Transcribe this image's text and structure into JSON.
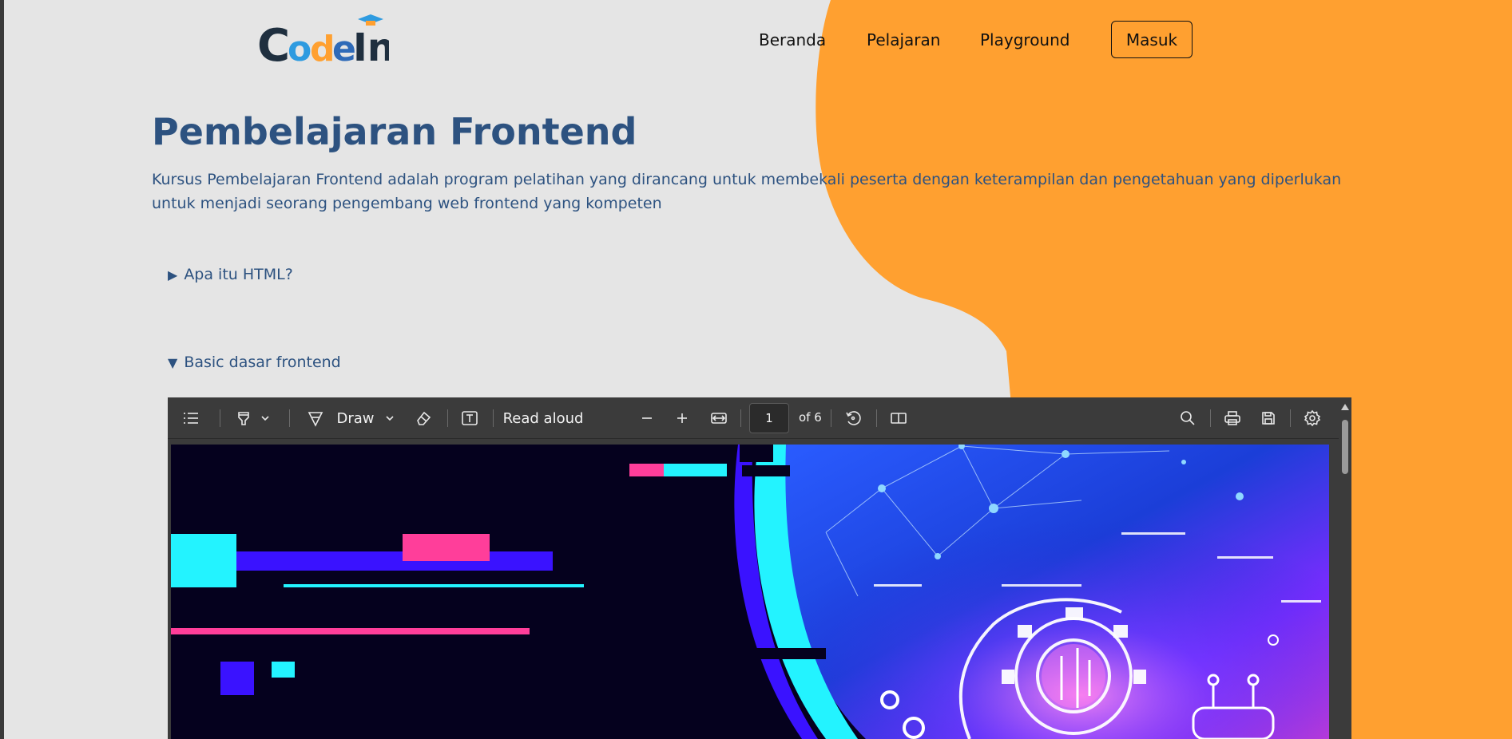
{
  "brand": {
    "logo_text": "CodeIn"
  },
  "nav": {
    "items": [
      "Beranda",
      "Pelajaran",
      "Playground"
    ],
    "login_label": "Masuk"
  },
  "hero": {
    "title": "Pembelajaran Frontend",
    "description": "Kursus Pembelajaran Frontend adalah program pelatihan yang dirancang untuk membekali peserta dengan keterampilan dan pengetahuan yang diperlukan untuk menjadi seorang pengembang web frontend yang kompeten"
  },
  "accordion": [
    {
      "label": "Apa itu HTML?",
      "expanded": false
    },
    {
      "label": "Basic dasar frontend",
      "expanded": true
    }
  ],
  "pdf_viewer": {
    "draw_label": "Draw",
    "read_aloud_label": "Read aloud",
    "current_page": "1",
    "page_total": "of 6"
  },
  "colors": {
    "background": "#e5e5e5",
    "accent_orange": "#ffa030",
    "heading_blue": "#2d5280",
    "viewer_bg": "#3b3b3b"
  }
}
